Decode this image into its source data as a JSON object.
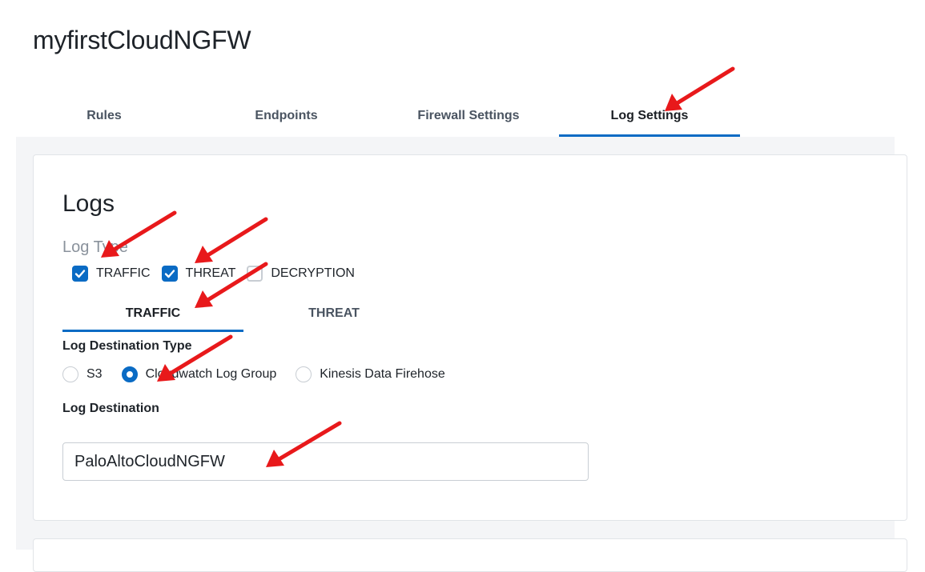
{
  "page_title": "myfirstCloudNGFW",
  "tabs": [
    {
      "label": "Rules"
    },
    {
      "label": "Endpoints"
    },
    {
      "label": "Firewall Settings"
    },
    {
      "label": "Log Settings",
      "active": true
    }
  ],
  "logs": {
    "title": "Logs",
    "log_type_label": "Log Type",
    "log_types": [
      {
        "label": "TRAFFIC",
        "checked": true
      },
      {
        "label": "THREAT",
        "checked": true
      },
      {
        "label": "DECRYPTION",
        "checked": false
      }
    ],
    "subtabs": [
      {
        "label": "TRAFFIC",
        "active": true
      },
      {
        "label": "THREAT"
      }
    ],
    "destination_type_label": "Log Destination Type",
    "destination_types": [
      {
        "label": "S3",
        "selected": false
      },
      {
        "label": "Cloudwatch Log Group",
        "selected": true
      },
      {
        "label": "Kinesis Data Firehose",
        "selected": false
      }
    ],
    "destination_label": "Log Destination",
    "destination_value": "PaloAltoCloudNGFW"
  },
  "colors": {
    "accent": "#0a6bc4",
    "annotation_arrow": "#e8191b"
  }
}
